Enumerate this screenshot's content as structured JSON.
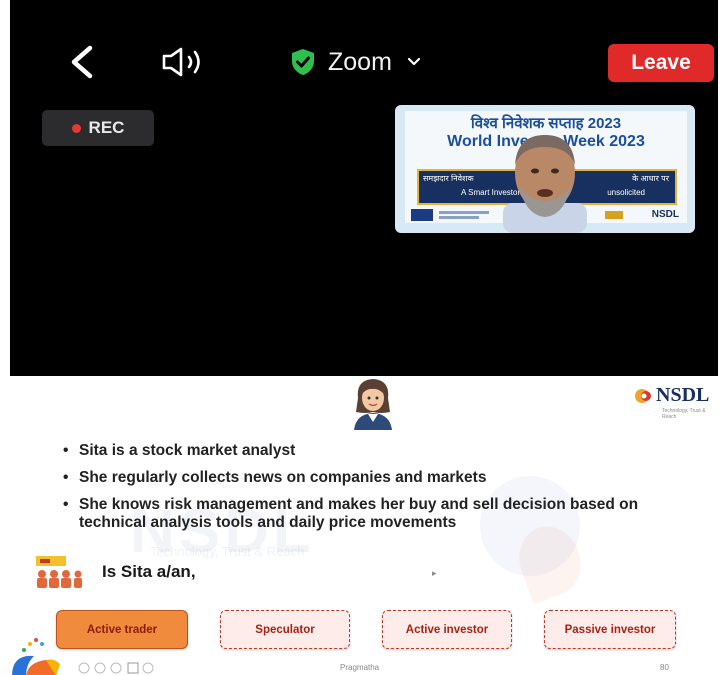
{
  "header": {
    "back_icon": "chevron-left-icon",
    "speaker_icon": "speaker-icon",
    "title": "Zoom",
    "title_icon": "shield-check-icon",
    "dropdown_icon": "chevron-down-icon",
    "leave_label": "Leave",
    "leave_color": "#e02a29",
    "secure_color": "#2fbf4f"
  },
  "video": {
    "rec_label": "REC",
    "pip": {
      "banner_hindi": "विश्व निवेशक सप्ताह 2023",
      "banner_english": "World Investor Week 2023",
      "strip_line1": "समझदार निवेशक",
      "strip_line2": "A Smart Investor",
      "footer_logo": "NSDL",
      "strip_right1": "के आधार पर",
      "strip_right2": "unsolicited"
    }
  },
  "slide": {
    "logo_text": "NSDL",
    "logo_tagline": "Technology, Trust & Reach",
    "character_icon": "businesswoman-icon",
    "bullets": [
      "Sita is a stock market analyst",
      "She regularly collects news on companies and markets",
      "She knows risk management and makes her buy and sell decision based on technical analysis tools and daily price movements"
    ],
    "question_icon": "audience-icon",
    "question": "Is Sita a/an,",
    "options": [
      {
        "label": "Active trader",
        "selected": true
      },
      {
        "label": "Speculator",
        "selected": false
      },
      {
        "label": "Active investor",
        "selected": false
      },
      {
        "label": "Passive investor",
        "selected": false
      }
    ],
    "footer_text": "Pragmatha",
    "page_number": "80",
    "selected_color": "#f08a3c",
    "option_color": "#fdecea"
  }
}
